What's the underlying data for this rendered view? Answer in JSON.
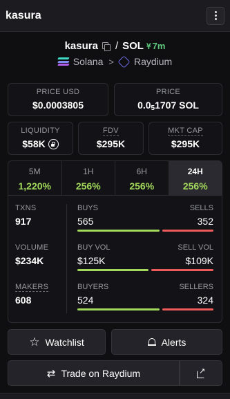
{
  "header": {
    "title": "kasura",
    "menu_icon": "more-vertical-icon"
  },
  "pair": {
    "base": "kasura",
    "separator": "/",
    "quote": "SOL",
    "age": "7m",
    "chain": "Solana",
    "dex": "Raydium",
    "chevron": ">"
  },
  "prices": {
    "usd_label": "PRICE USD",
    "usd_value": "$0.0003805",
    "sol_label": "PRICE",
    "sol_prefix": "0.0",
    "sol_zeros": "5",
    "sol_suffix": "1707 SOL"
  },
  "metrics": {
    "liquidity_label": "LIQUIDITY",
    "liquidity_value": "$58K",
    "fdv_label": "FDV",
    "fdv_value": "$295K",
    "mcap_label": "MKT CAP",
    "mcap_value": "$295K"
  },
  "timeframes": [
    {
      "label": "5M",
      "change": "1,220%"
    },
    {
      "label": "1H",
      "change": "256%"
    },
    {
      "label": "6H",
      "change": "256%"
    },
    {
      "label": "24H",
      "change": "256%"
    }
  ],
  "stats": {
    "txns_label": "TXNS",
    "txns_value": "917",
    "volume_label": "VOLUME",
    "volume_value": "$234K",
    "makers_label": "MAKERS",
    "makers_value": "608",
    "buys_label": "BUYS",
    "buys_value": "565",
    "sells_label": "SELLS",
    "sells_value": "352",
    "buy_vol_label": "BUY VOL",
    "buy_vol_value": "$125K",
    "sell_vol_label": "SELL VOL",
    "sell_vol_value": "$109K",
    "buyers_label": "BUYERS",
    "buyers_value": "524",
    "sellers_label": "SELLERS",
    "sellers_value": "324",
    "buys_ratio": 0.616,
    "buy_vol_ratio": 0.534,
    "buyers_ratio": 0.618
  },
  "actions": {
    "watchlist": "Watchlist",
    "alerts": "Alerts",
    "trade": "Trade on Raydium"
  },
  "colors": {
    "green": "#a3d95a",
    "red": "#ef5a5a",
    "age_green": "#5ec97c"
  }
}
